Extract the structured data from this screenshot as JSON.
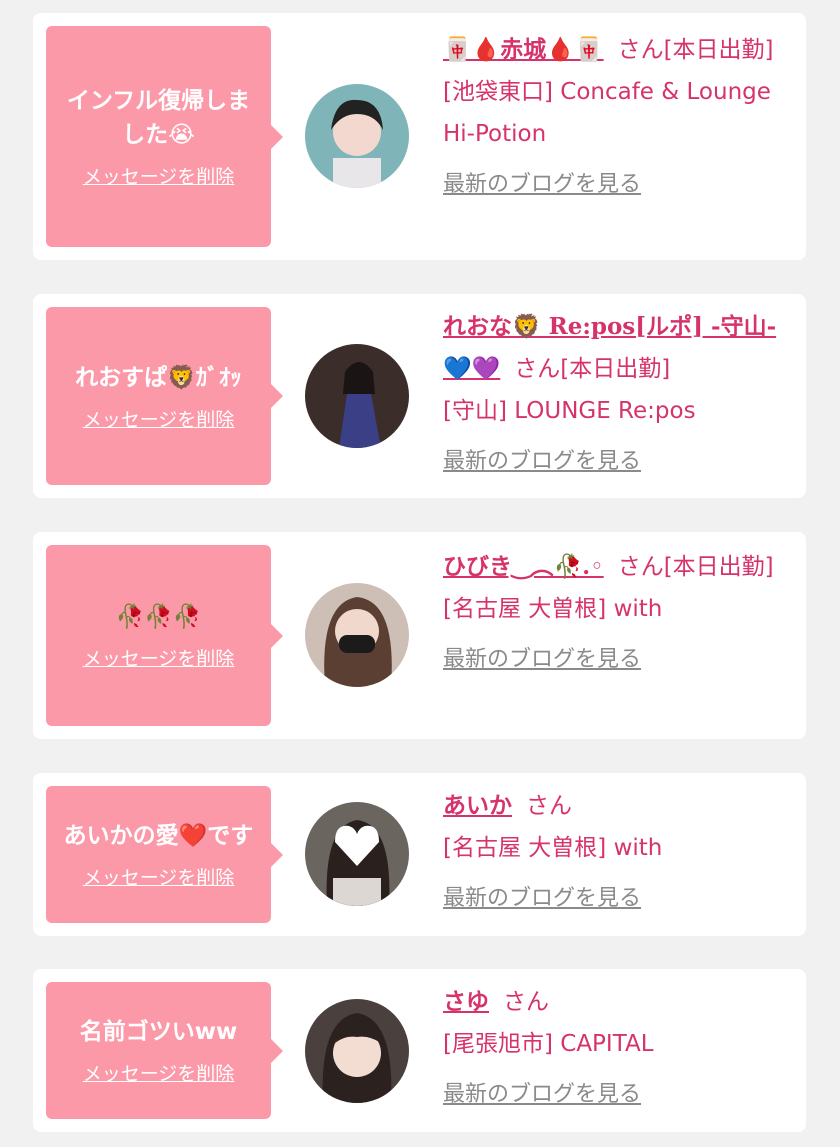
{
  "common": {
    "delete_label": "メッセージを削除",
    "blog_label": "最新のブログを見る",
    "honorific": "さん"
  },
  "colors": {
    "background": "#f1f1f1",
    "card": "#ffffff",
    "bubble": "#fc99a9",
    "accent_text": "#d6336c",
    "link_gray": "#8a8a8a"
  },
  "items": [
    {
      "message": "インフル復帰しました😭",
      "name": "🀄🩸赤城🩸🀄",
      "status": "[本日出勤]",
      "shop": "[池袋東口] Concafe & Lounge Hi-Potion",
      "avatar_icon": "avatar-photo"
    },
    {
      "message": "れおすぱ🦁ｶﾞｵｯ",
      "name": "れおな🦁 Re:pos[ルポ] -守山-💙💜",
      "status": "[本日出勤]",
      "shop": "[守山] LOUNGE Re:pos",
      "avatar_icon": "avatar-photo"
    },
    {
      "message": "🥀🥀🥀",
      "name": "ひびき‿︵🥀.◦",
      "status": "[本日出勤]",
      "shop": "[名古屋 大曽根] with",
      "avatar_icon": "avatar-photo"
    },
    {
      "message": "あいかの愛❤️です",
      "name": "あいか",
      "status": "",
      "shop": "[名古屋 大曽根] with",
      "avatar_icon": "avatar-photo"
    },
    {
      "message": "名前ゴツいww",
      "name": "さゆ",
      "status": "",
      "shop": "[尾張旭市] CAPITAL",
      "avatar_icon": "avatar-photo"
    }
  ]
}
